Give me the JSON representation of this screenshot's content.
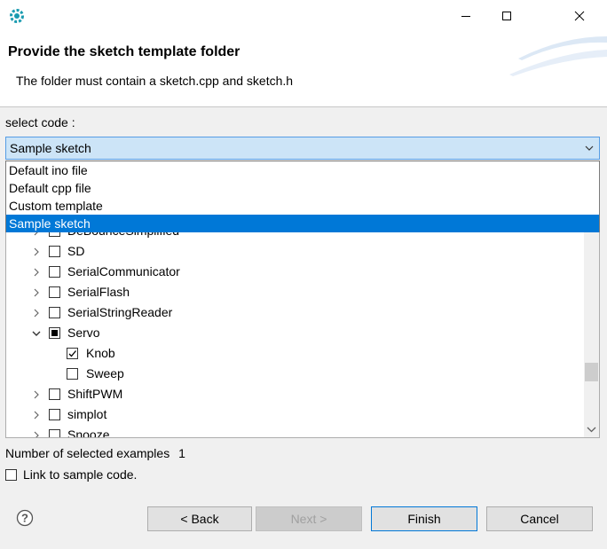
{
  "header": {
    "title": "Provide the sketch template folder",
    "description": "The folder must contain a sketch.cpp and sketch.h"
  },
  "select_code": {
    "label": "select code :",
    "value": "Sample sketch",
    "options": [
      "Default ino file",
      "Default cpp file",
      "Custom template",
      "Sample sketch"
    ]
  },
  "tree": {
    "items": [
      {
        "label": "DeBounceSimplified",
        "expanded": false,
        "state": "unchecked"
      },
      {
        "label": "SD",
        "expanded": false,
        "state": "unchecked"
      },
      {
        "label": "SerialCommunicator",
        "expanded": false,
        "state": "unchecked"
      },
      {
        "label": "SerialFlash",
        "expanded": false,
        "state": "unchecked"
      },
      {
        "label": "SerialStringReader",
        "expanded": false,
        "state": "unchecked"
      },
      {
        "label": "Servo",
        "expanded": true,
        "state": "partial"
      },
      {
        "label": "Knob",
        "state": "checked"
      },
      {
        "label": "Sweep",
        "state": "unchecked"
      },
      {
        "label": "ShiftPWM",
        "expanded": false,
        "state": "unchecked"
      },
      {
        "label": "simplot",
        "expanded": false,
        "state": "unchecked"
      },
      {
        "label": "Snooze",
        "expanded": false,
        "state": "unchecked"
      }
    ]
  },
  "examples": {
    "label": "Number of selected examples",
    "count": "1"
  },
  "link": {
    "label": "Link to sample code."
  },
  "buttons": {
    "back": "< Back",
    "next": "Next >",
    "finish": "Finish",
    "cancel": "Cancel"
  },
  "colors": {
    "selection": "#0078d7",
    "combo_bg": "#cce4f7",
    "combo_border": "#569de5"
  },
  "icons": {
    "app": "gear-icon",
    "help": "help-icon"
  }
}
